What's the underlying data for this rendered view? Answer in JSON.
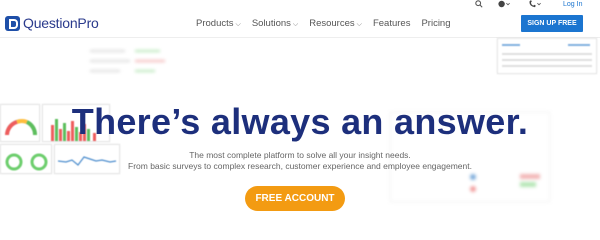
{
  "brand": {
    "name": "QuestionPro"
  },
  "utility": {
    "search_icon": "search-icon",
    "globe_icon": "globe-icon",
    "phone_icon": "phone-icon",
    "login_label": "Log In"
  },
  "nav": {
    "items": [
      {
        "label": "Products",
        "has_dropdown": true
      },
      {
        "label": "Solutions",
        "has_dropdown": true
      },
      {
        "label": "Resources",
        "has_dropdown": true
      },
      {
        "label": "Features",
        "has_dropdown": false
      },
      {
        "label": "Pricing",
        "has_dropdown": false
      }
    ],
    "signup_label": "SIGN UP FREE"
  },
  "hero": {
    "headline": "There’s always an answer.",
    "sub_line1": "The most complete platform to solve all your insight needs.",
    "sub_line2": "From basic surveys to complex research, customer experience and employee engagement.",
    "cta_label": "FREE ACCOUNT"
  },
  "colors": {
    "brand_blue": "#1d2f7c",
    "accent_blue": "#1b75d0",
    "cta_orange": "#f39b12"
  }
}
